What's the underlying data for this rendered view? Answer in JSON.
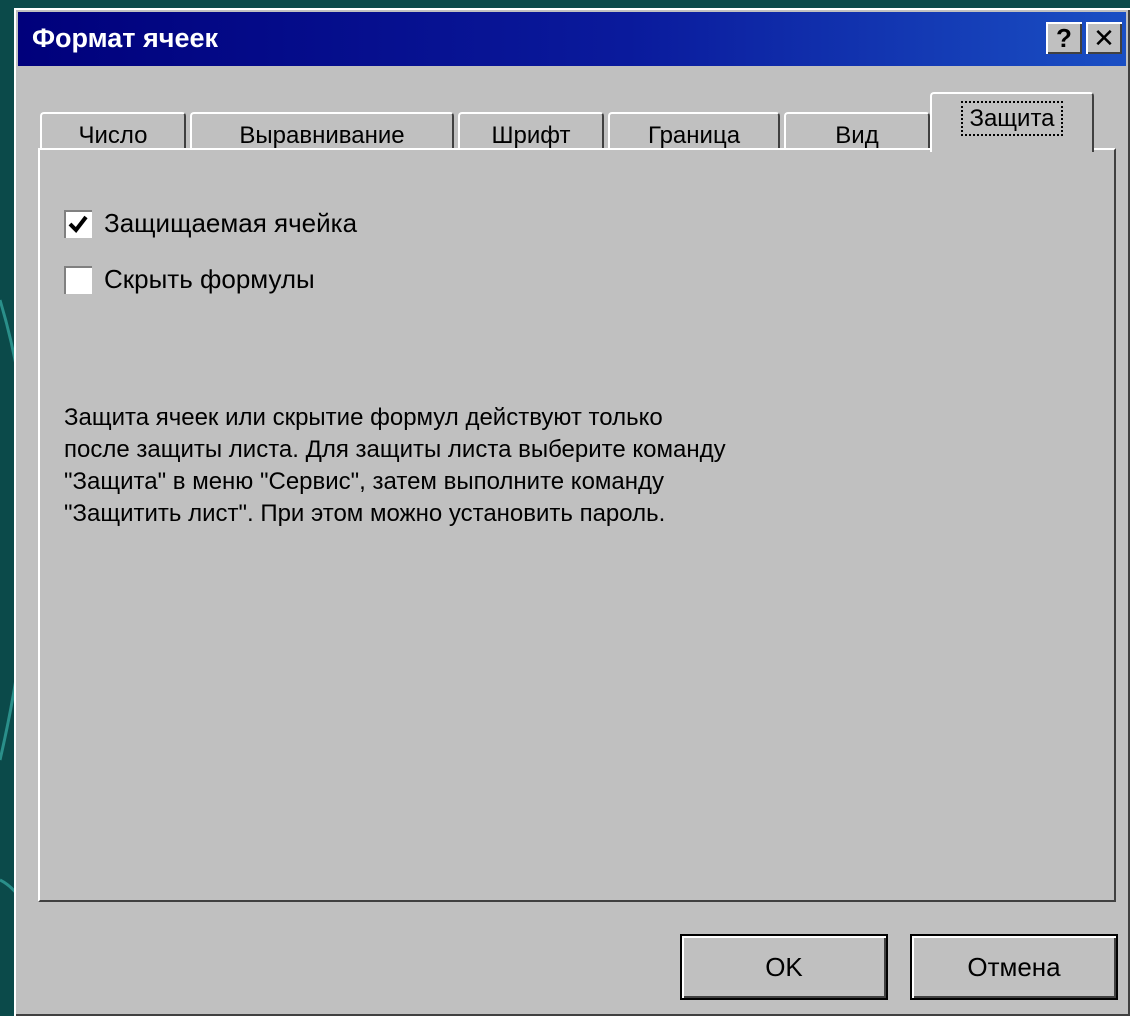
{
  "dialog": {
    "title": "Формат ячеек",
    "help_label": "?",
    "close_label": "✕"
  },
  "tabs": [
    {
      "label": "Число",
      "active": false
    },
    {
      "label": "Выравнивание",
      "active": false
    },
    {
      "label": "Шрифт",
      "active": false
    },
    {
      "label": "Граница",
      "active": false
    },
    {
      "label": "Вид",
      "active": false
    },
    {
      "label": "Защита",
      "active": true
    }
  ],
  "protection": {
    "locked_label": "Защищаемая ячейка",
    "locked_checked": true,
    "hidden_label": "Скрыть формулы",
    "hidden_checked": false,
    "info_lines": [
      "Защита ячеек или скрытие формул действуют только",
      "после защиты листа. Для защиты листа выберите команду",
      "\"Защита\" в меню \"Сервис\", затем выполните команду",
      "\"Защитить лист\". При этом можно установить пароль."
    ]
  },
  "buttons": {
    "ok_label": "OK",
    "cancel_label": "Отмена"
  },
  "colors": {
    "titlebar": "#00007b",
    "face": "#c0c0c0",
    "desktop": "#0b4a4a"
  }
}
